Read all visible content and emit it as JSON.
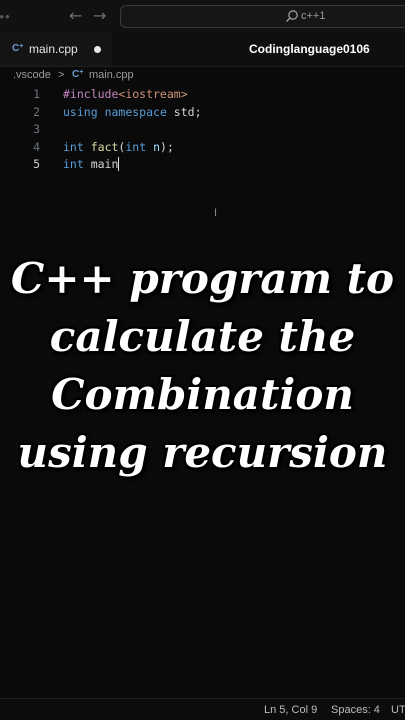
{
  "titlebar": {
    "search_text": "c++1"
  },
  "tabs": [
    {
      "icon": "C",
      "label": "main.cpp"
    }
  ],
  "watermark": "Codinglanguage0106",
  "breadcrumb": {
    "folder": ".vscode",
    "separator": ">",
    "file": "main.cpp"
  },
  "editor": {
    "lines": [
      {
        "number": "1",
        "parts": [
          [
            "kw-pre",
            "#include"
          ],
          [
            "str",
            "<iostream>"
          ]
        ]
      },
      {
        "number": "2",
        "parts": [
          [
            "kw-other",
            "using"
          ],
          [
            "plain",
            " "
          ],
          [
            "kw-other",
            "namespace"
          ],
          [
            "plain",
            " std;"
          ]
        ]
      },
      {
        "number": "3",
        "parts": []
      },
      {
        "number": "4",
        "parts": [
          [
            "kw-type",
            "int"
          ],
          [
            "plain",
            " "
          ],
          [
            "fn",
            "fact"
          ],
          [
            "plain",
            "("
          ],
          [
            "kw-type",
            "int"
          ],
          [
            "plain",
            " "
          ],
          [
            "var",
            "n"
          ],
          [
            "plain",
            ");"
          ]
        ]
      },
      {
        "number": "5",
        "parts": [
          [
            "kw-type",
            "int"
          ],
          [
            "plain",
            " main"
          ]
        ]
      }
    ],
    "active_line": "5"
  },
  "overlay": {
    "line1": "C++ program to",
    "line2": "calculate the",
    "line3": "Combination",
    "line4": "using recursion"
  },
  "statusbar": {
    "position": "Ln 5, Col 9",
    "spaces": "Spaces: 4",
    "encoding": "UT"
  },
  "colors": {
    "background": "#0a0a0a",
    "accent_icon": "#6c9bd4",
    "keyword": "#569cd6",
    "preprocessor": "#c586c0"
  }
}
